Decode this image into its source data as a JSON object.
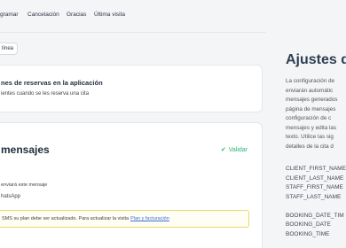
{
  "topnav": {
    "tabs": [
      "gramar",
      "Cancelación",
      "Gracias",
      "Última visita"
    ]
  },
  "online_pill": "línea",
  "card_reservations": {
    "title": "nes de reservas en la aplicación",
    "description": "ientes cuando se les reserva una cita"
  },
  "card_messages": {
    "title": "mensajes",
    "status": "Validar",
    "status_color": "#2bb673",
    "subtitle": "enviará este mensaje",
    "channel": "hatsApp",
    "warning_text": "SMS su plan debe ser actualizado. Para actualizar la visita",
    "warning_link": "Plan y facturación"
  },
  "settings_panel": {
    "heading": "Ajustes d",
    "paragraph_lines": [
      "La configuración de",
      "enviarán automátic",
      "mensajes generados",
      "página de mensajes",
      "configuración de c",
      "mensajes y edita las",
      "texto. Utilice las sig",
      "detalles de la cita d"
    ],
    "variables_group1": [
      "CLIENT_FIRST_NAME",
      "CLIENT_LAST_NAME",
      "STAFF_FIRST_NAME",
      "STAFF_LAST_NAME"
    ],
    "variables_group2": [
      "BOOKING_DATE_TIM",
      "BOOKING_DATE",
      "BOOKING_TIME"
    ]
  }
}
